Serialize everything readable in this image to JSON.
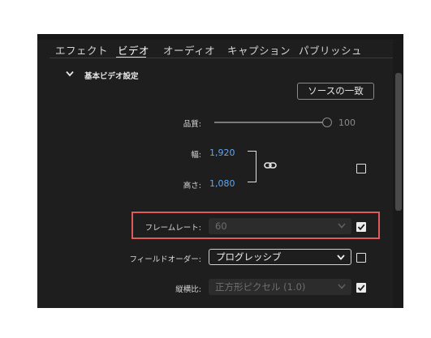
{
  "tabs": [
    {
      "label": "エフェクト"
    },
    {
      "label": "ビデオ"
    },
    {
      "label": "オーディオ"
    },
    {
      "label": "キャプション"
    },
    {
      "label": "パブリッシュ"
    }
  ],
  "active_tab": "ビデオ",
  "section": {
    "title": "基本ビデオ設定"
  },
  "match_source_button": "ソースの一致",
  "quality": {
    "label": "品質:",
    "value": "100"
  },
  "width": {
    "label": "幅:",
    "value": "1,920"
  },
  "height": {
    "label": "高さ:",
    "value": "1,080"
  },
  "frame_rate": {
    "label": "フレームレート:",
    "value": "60",
    "checked": true
  },
  "field_order": {
    "label": "フィールドオーダー:",
    "value": "プログレッシブ",
    "checked": false
  },
  "aspect": {
    "label": "縦横比:",
    "value": "正方形ピクセル (1.0)",
    "checked": true
  },
  "colors": {
    "accent_blue": "#62a8f2",
    "highlight_red": "#e05a5a",
    "panel_bg": "#1e1e1e"
  }
}
